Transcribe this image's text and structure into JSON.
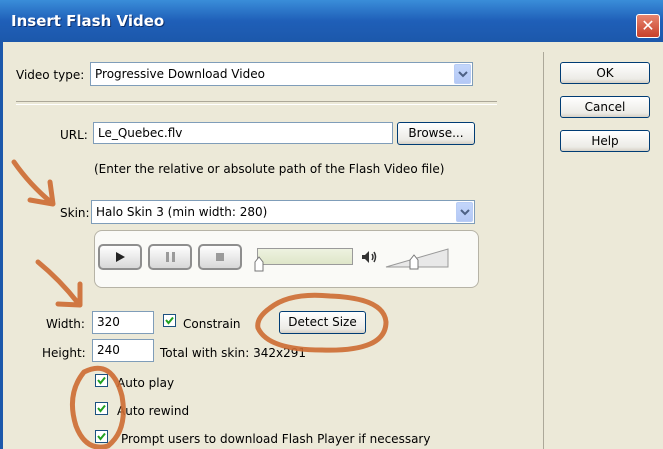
{
  "window": {
    "title": "Insert Flash Video",
    "close_glyph": "✕"
  },
  "buttons": {
    "ok": "OK",
    "cancel": "Cancel",
    "help": "Help",
    "browse": "Browse...",
    "detect_size": "Detect Size"
  },
  "video_type": {
    "label": "Video type:",
    "value": "Progressive Download Video"
  },
  "url": {
    "label": "URL:",
    "value": "Le_Quebec.flv",
    "hint": "(Enter the relative or absolute path of the Flash Video file)"
  },
  "skin": {
    "label": "Skin:",
    "value": "Halo Skin 3 (min width: 280)"
  },
  "width": {
    "label": "Width:",
    "value": "320"
  },
  "height": {
    "label": "Height:",
    "value": "240"
  },
  "constrain": {
    "label": "Constrain",
    "checked": true
  },
  "total_with_skin": "Total with skin: 342x291",
  "options": [
    {
      "label": "Auto play",
      "checked": true
    },
    {
      "label": "Auto rewind",
      "checked": true
    },
    {
      "label": "Prompt users to download Flash Player if necessary",
      "checked": true
    }
  ],
  "colors": {
    "annotation": "#cd6b32",
    "titlebar": "#1f5fb8",
    "dialog_bg": "#ece9d8"
  }
}
